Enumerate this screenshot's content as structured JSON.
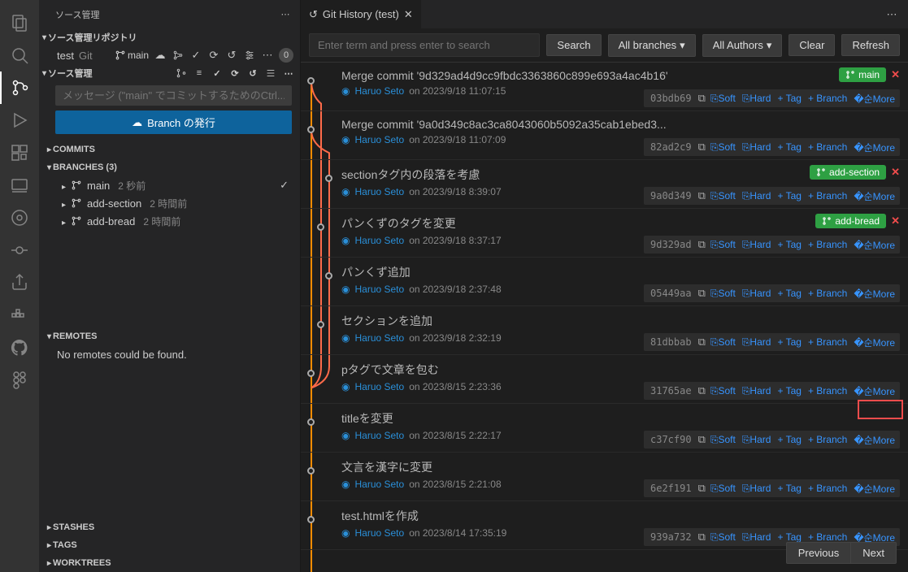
{
  "sidebar": {
    "title": "ソース管理",
    "repos_header": "ソース管理リポジトリ",
    "scm_header": "ソース管理",
    "repo": {
      "name": "test",
      "type": "Git",
      "branch": "main",
      "badge": "0"
    },
    "message_placeholder": "メッセージ (\"main\" でコミットするためのCtrl...",
    "publish_label": "Branch の発行",
    "commits_label": "COMMITS",
    "branches_label": "BRANCHES (3)",
    "branches": [
      {
        "name": "main",
        "meta": "2 秒前",
        "current": true
      },
      {
        "name": "add-section",
        "meta": "2 時間前",
        "current": false
      },
      {
        "name": "add-bread",
        "meta": "2 時間前",
        "current": false
      }
    ],
    "remotes_label": "REMOTES",
    "no_remotes": "No remotes could be found.",
    "stashes_label": "STASHES",
    "tags_label": "TAGS",
    "worktrees_label": "WORKTREES"
  },
  "tab": {
    "title": "Git History (test)"
  },
  "toolbar": {
    "search_placeholder": "Enter term and press enter to search",
    "search": "Search",
    "branches": "All branches",
    "authors": "All Authors",
    "clear": "Clear",
    "refresh": "Refresh"
  },
  "actions": {
    "soft": "Soft",
    "hard": "Hard",
    "tag": "Tag",
    "branch": "Branch",
    "more": "More"
  },
  "pagination": {
    "prev": "Previous",
    "next": "Next"
  },
  "commits": [
    {
      "title": "Merge commit '9d329ad4d9cc9fbdc3363860c899e693a4ac4b16'",
      "author": "Haruo Seto",
      "date": "on 2023/9/18 11:07:15",
      "hash": "03bdb69",
      "branch": "main"
    },
    {
      "title": "Merge commit '9a0d349c8ac3ca8043060b5092a35cab1ebed3...",
      "author": "Haruo Seto",
      "date": "on 2023/9/18 11:07:09",
      "hash": "82ad2c9",
      "branch": null
    },
    {
      "title": "sectionタグ内の段落を考慮",
      "author": "Haruo Seto",
      "date": "on 2023/9/18 8:39:07",
      "hash": "9a0d349",
      "branch": "add-section"
    },
    {
      "title": "パンくずのタグを変更",
      "author": "Haruo Seto",
      "date": "on 2023/9/18 8:37:17",
      "hash": "9d329ad",
      "branch": "add-bread"
    },
    {
      "title": "パンくず追加",
      "author": "Haruo Seto",
      "date": "on 2023/9/18 2:37:48",
      "hash": "05449aa",
      "branch": null
    },
    {
      "title": "セクションを追加",
      "author": "Haruo Seto",
      "date": "on 2023/9/18 2:32:19",
      "hash": "81dbbab",
      "branch": null
    },
    {
      "title": "pタグで文章を包む",
      "author": "Haruo Seto",
      "date": "on 2023/8/15 2:23:36",
      "hash": "31765ae",
      "branch": null
    },
    {
      "title": "titleを変更",
      "author": "Haruo Seto",
      "date": "on 2023/8/15 2:22:17",
      "hash": "c37cf90",
      "branch": null
    },
    {
      "title": "文言を漢字に変更",
      "author": "Haruo Seto",
      "date": "on 2023/8/15 2:21:08",
      "hash": "6e2f191",
      "branch": null
    },
    {
      "title": "test.htmlを作成",
      "author": "Haruo Seto",
      "date": "on 2023/8/14 17:35:19",
      "hash": "939a732",
      "branch": null
    }
  ]
}
